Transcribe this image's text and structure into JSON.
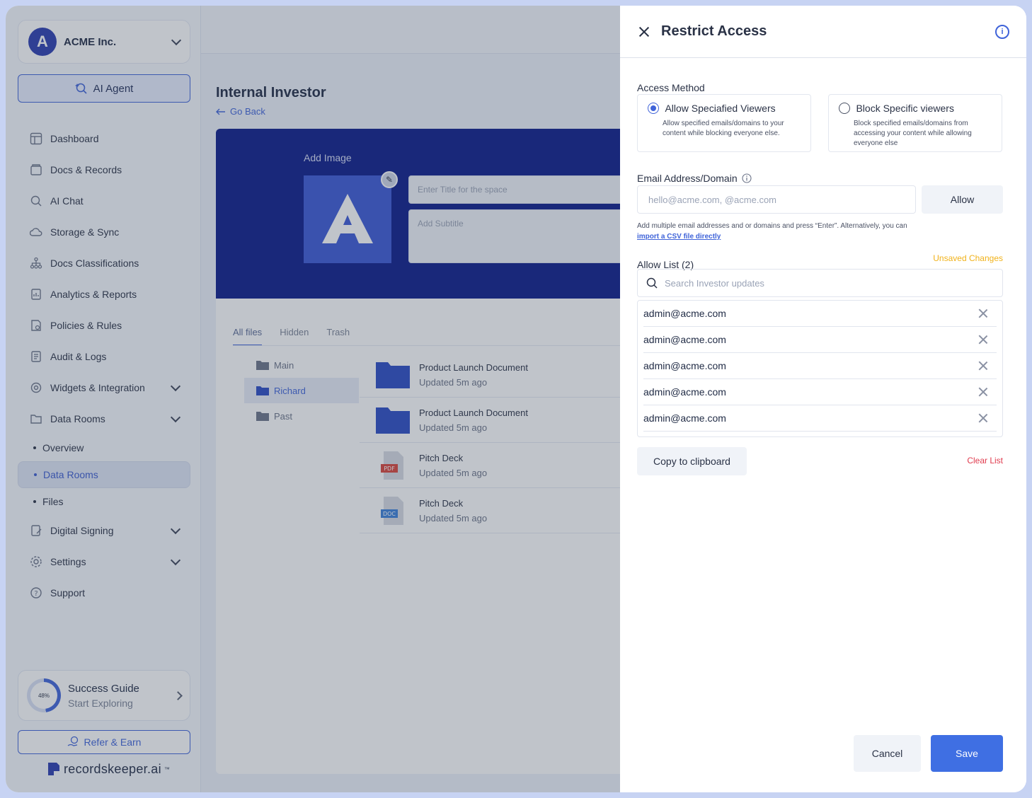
{
  "org": {
    "initial": "A",
    "name": "ACME Inc."
  },
  "sidebar": {
    "ai_agent": "AI Agent",
    "items": [
      {
        "label": "Dashboard",
        "icon": "dashboard-icon"
      },
      {
        "label": "Docs & Records",
        "icon": "docs-icon"
      },
      {
        "label": "AI Chat",
        "icon": "ai-chat-icon"
      },
      {
        "label": "Storage & Sync",
        "icon": "cloud-sync-icon"
      },
      {
        "label": "Docs Classifications",
        "icon": "hierarchy-icon"
      },
      {
        "label": "Analytics & Reports",
        "icon": "analytics-icon"
      },
      {
        "label": "Policies & Rules",
        "icon": "policy-icon"
      },
      {
        "label": "Audit & Logs",
        "icon": "audit-icon"
      },
      {
        "label": "Widgets & Integration",
        "icon": "widgets-icon"
      },
      {
        "label": "Data Rooms",
        "icon": "data-rooms-icon"
      }
    ],
    "sub_items": [
      "Overview",
      "Data Rooms",
      "Files"
    ],
    "items_after": [
      {
        "label": "Digital Signing",
        "icon": "signing-icon"
      },
      {
        "label": "Settings",
        "icon": "gear-icon"
      },
      {
        "label": "Support",
        "icon": "help-icon"
      }
    ],
    "guide": {
      "percent": "48%",
      "title": "Success Guide",
      "subtitle": "Start Exploring"
    },
    "refer": "Refer & Earn",
    "brand": "recordskeeper.ai",
    "brand_tm": "™"
  },
  "main": {
    "title": "Internal Investor",
    "go_back": "Go Back",
    "banner": {
      "add_image": "Add Image",
      "logo_letter": "A",
      "title_placeholder": "Enter Title for the space",
      "subtitle_placeholder": "Add Subtitle"
    },
    "tabs": [
      "All files",
      "Hidden",
      "Trash"
    ],
    "folders": [
      "Main",
      "Richard",
      "Past"
    ],
    "files": [
      {
        "name": "Product Launch Document",
        "updated": "Updated 5m ago",
        "type": "folder"
      },
      {
        "name": "Product Launch Document",
        "updated": "Updated 5m ago",
        "type": "folder"
      },
      {
        "name": "Pitch Deck",
        "updated": "Updated 5m ago",
        "type": "PDF"
      },
      {
        "name": "Pitch Deck",
        "updated": "Updated 5m ago",
        "type": "DOC"
      }
    ]
  },
  "drawer": {
    "title": "Restrict Access",
    "access_method_label": "Access Method",
    "methods": [
      {
        "title": "Allow Speciafied Viewers",
        "desc": "Allow specified emails/domains to your content while blocking everyone else.",
        "selected": true
      },
      {
        "title": "Block Specific viewers",
        "desc": "Block specified emails/domains from accessing your content while allowing everyone else",
        "selected": false
      }
    ],
    "email_label": "Email Address/Domain",
    "email_placeholder": "hello@acme.com, @acme.com",
    "allow_button": "Allow",
    "hint_text": "Add multiple email addresses and or domains and press “Enter”. Alternatively, you can ",
    "hint_link": "import a CSV file directly",
    "allow_list_label": "Allow List (2)",
    "unsaved": "Unsaved Changes",
    "search_placeholder": "Search Investor updates",
    "list": [
      "admin@acme.com",
      "admin@acme.com",
      "admin@acme.com",
      "admin@acme.com",
      "admin@acme.com"
    ],
    "copy_button": "Copy to clipboard",
    "clear_list": "Clear List",
    "cancel_button": "Cancel",
    "save_button": "Save"
  },
  "colors": {
    "accent": "#3f63d9",
    "banner": "#0a1a8a",
    "warning": "#f1b21a",
    "danger": "#e03b4e"
  }
}
